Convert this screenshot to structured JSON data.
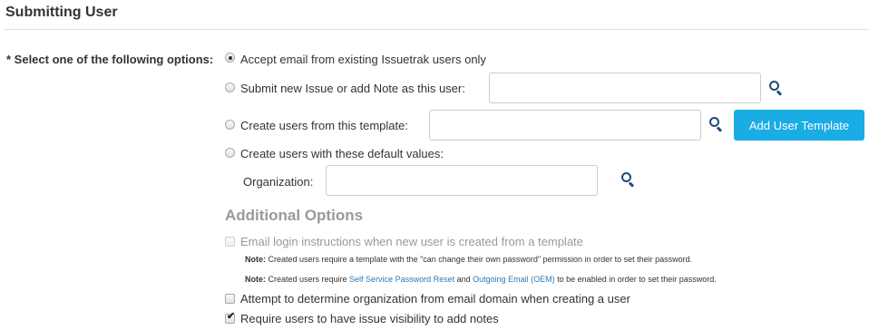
{
  "section": {
    "title": "Submitting User"
  },
  "options_label": "* Select one of the following options:",
  "options": {
    "accept_existing": {
      "label": "Accept email from existing Issuetrak users only",
      "checked": true
    },
    "submit_as_user": {
      "label": "Submit new Issue or add Note as this user:",
      "value": "",
      "checked": false
    },
    "from_template": {
      "label": "Create users from this template:",
      "value": "",
      "checked": false,
      "button": "Add User Template"
    },
    "default_values": {
      "label": "Create users with these default values:",
      "checked": false
    }
  },
  "organization": {
    "label": "Organization:",
    "value": ""
  },
  "additional": {
    "title": "Additional Options",
    "email_login": {
      "label": "Email login instructions when new user is created from a template",
      "checked": false,
      "disabled": true
    },
    "note1": {
      "prefix": "Note:",
      "text": " Created users require a template with the \"can change their own password\" permission in order to set their password."
    },
    "note2": {
      "prefix": "Note:",
      "text_a": " Created users require ",
      "link_a": "Self Service Password Reset",
      "text_b": " and ",
      "link_b": "Outgoing Email (OEM)",
      "text_c": " to be enabled in order to set their password."
    },
    "org_from_domain": {
      "label": "Attempt to determine organization from email domain when creating a user",
      "checked": false
    },
    "require_visibility": {
      "label": "Require users to have issue visibility to add notes",
      "checked": true
    }
  },
  "icons": {
    "search": "search-icon",
    "accent_color": "#1aace4",
    "icon_color": "#1f4a78"
  }
}
